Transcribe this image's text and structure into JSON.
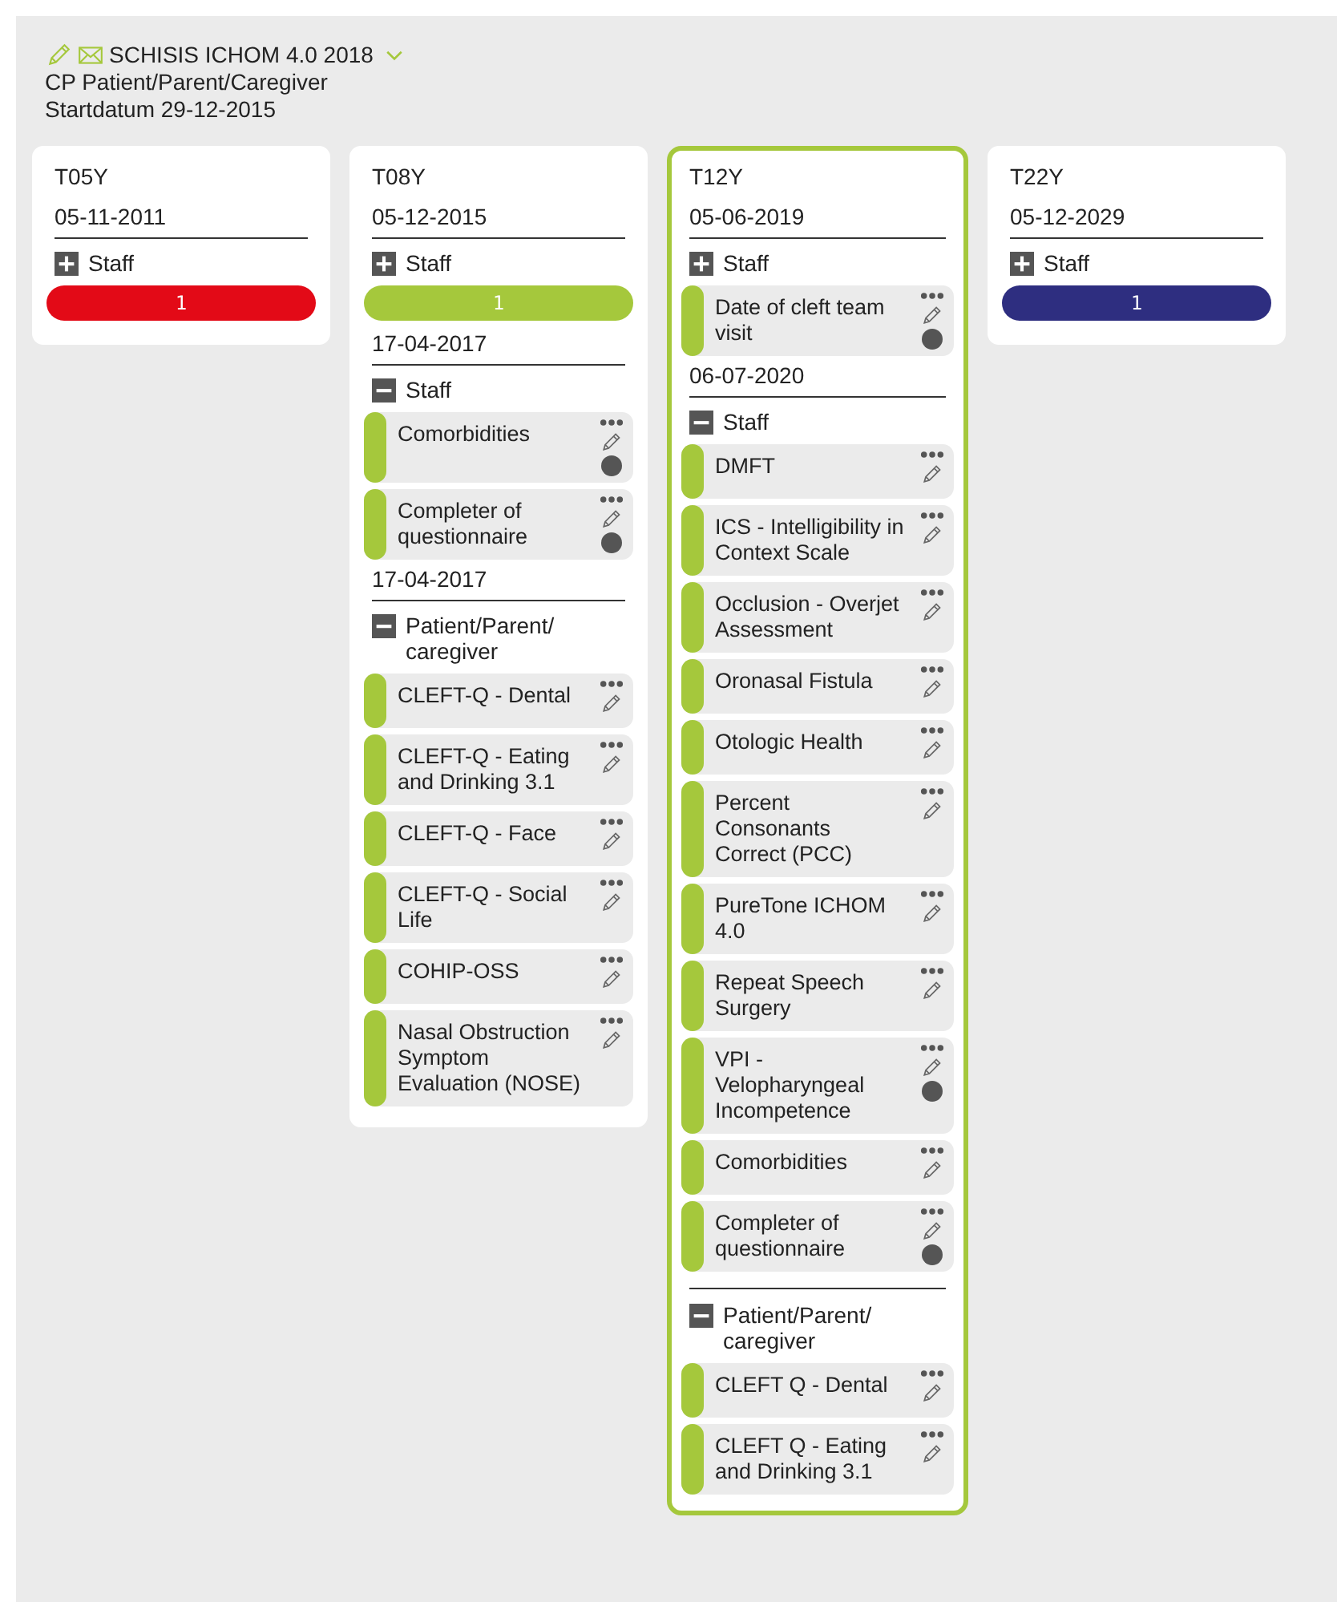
{
  "header": {
    "title": "SCHISIS ICHOM 4.0 2018",
    "subtitle": "CP Patient/Parent/Caregiver",
    "start_date": "Startdatum 29-12-2015"
  },
  "columns": [
    {
      "title": "T05Y",
      "selected": false,
      "sessions": [
        {
          "date": "05-11-2011",
          "groups": [
            {
              "label": "Staff",
              "expanded": false,
              "count": "1",
              "color": "#e30a17"
            }
          ]
        }
      ]
    },
    {
      "title": "T08Y",
      "selected": false,
      "sessions": [
        {
          "date": "05-12-2015",
          "groups": [
            {
              "label": "Staff",
              "expanded": false,
              "count": "1",
              "color": "#a5c83c"
            }
          ]
        },
        {
          "date": "17-04-2017",
          "groups": [
            {
              "label": "Staff",
              "expanded": true,
              "items": [
                {
                  "label": "Comorbidities",
                  "completed": true
                },
                {
                  "label": "Completer of questionnaire",
                  "completed": true
                }
              ]
            }
          ]
        },
        {
          "date": "17-04-2017",
          "groups": [
            {
              "label": "Patient/Parent/ caregiver",
              "expanded": true,
              "items": [
                {
                  "label": "CLEFT-Q - Dental",
                  "completed": false
                },
                {
                  "label": "CLEFT-Q - Eating and Drinking 3.1",
                  "completed": false
                },
                {
                  "label": "CLEFT-Q - Face",
                  "completed": false
                },
                {
                  "label": "CLEFT-Q - Social Life",
                  "completed": false
                },
                {
                  "label": "COHIP-OSS",
                  "completed": false
                },
                {
                  "label": "Nasal Obstruction Symptom Evaluation (NOSE)",
                  "completed": false
                }
              ]
            }
          ]
        }
      ]
    },
    {
      "title": "T12Y",
      "selected": true,
      "sessions": [
        {
          "date": "05-06-2019",
          "groups": [
            {
              "label": "Staff",
              "expanded": false,
              "items": [
                {
                  "label": "Date of cleft team visit",
                  "completed": true
                }
              ]
            }
          ]
        },
        {
          "date": "06-07-2020",
          "groups": [
            {
              "label": "Staff",
              "expanded": true,
              "items": [
                {
                  "label": "DMFT",
                  "completed": false
                },
                {
                  "label": "ICS - Intelligibility in Context Scale",
                  "completed": false
                },
                {
                  "label": "Occlusion - Overjet Assessment",
                  "completed": false
                },
                {
                  "label": "Oronasal Fistula",
                  "completed": false
                },
                {
                  "label": "Otologic Health",
                  "completed": false
                },
                {
                  "label": "Percent Consonants Correct (PCC)",
                  "completed": false
                },
                {
                  "label": "PureTone ICHOM 4.0",
                  "completed": false
                },
                {
                  "label": "Repeat Speech Surgery",
                  "completed": false
                },
                {
                  "label": "VPI - Velopharyngeal Incompetence",
                  "completed": true
                },
                {
                  "label": "Comorbidities",
                  "completed": false
                },
                {
                  "label": "Completer of questionnaire",
                  "completed": true
                }
              ]
            },
            {
              "label": "Patient/Parent/ caregiver",
              "expanded": true,
              "items": [
                {
                  "label": "CLEFT Q - Dental",
                  "completed": false
                },
                {
                  "label": "CLEFT Q - Eating and Drinking 3.1",
                  "completed": false
                }
              ]
            }
          ]
        }
      ]
    },
    {
      "title": "T22Y",
      "selected": false,
      "sessions": [
        {
          "date": "05-12-2029",
          "groups": [
            {
              "label": "Staff",
              "expanded": false,
              "count": "1",
              "color": "#2e2e80"
            }
          ]
        }
      ]
    }
  ]
}
